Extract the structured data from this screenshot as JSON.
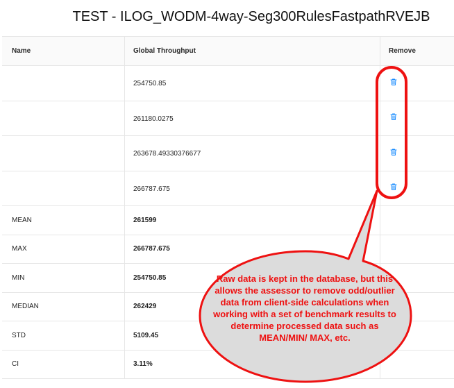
{
  "title": "TEST - ILOG_WODM-4way-Seg300RulesFastpathRVEJB",
  "table": {
    "columns": {
      "name": "Name",
      "throughput": "Global Throughput",
      "remove": "Remove"
    },
    "raw_rows": [
      {
        "name": "",
        "value": "254750.85",
        "remove_icon": "trash-icon"
      },
      {
        "name": "",
        "value": "261180.0275",
        "remove_icon": "trash-icon"
      },
      {
        "name": "",
        "value": "263678.49330376677",
        "remove_icon": "trash-icon"
      },
      {
        "name": "",
        "value": "266787.675",
        "remove_icon": "trash-icon"
      }
    ],
    "stats": [
      {
        "name": "MEAN",
        "value": "261599"
      },
      {
        "name": "MAX",
        "value": "266787.675"
      },
      {
        "name": "MIN",
        "value": "254750.85"
      },
      {
        "name": "MEDIAN",
        "value": "262429"
      },
      {
        "name": "STD",
        "value": "5109.45"
      },
      {
        "name": "CI",
        "value": "3.11%"
      }
    ]
  },
  "annotation": {
    "text": "Raw data is kept in the database, but this allows the assessor to remove odd/outlier data from client-side calculations when working with a set of benchmark results to determine processed data such as MEAN/MIN/ MAX, etc."
  },
  "colors": {
    "icon": "#1a8cff",
    "annotation": "#ee1111",
    "callout_fill": "#dcdcdc",
    "border": "#e6e6e6"
  }
}
